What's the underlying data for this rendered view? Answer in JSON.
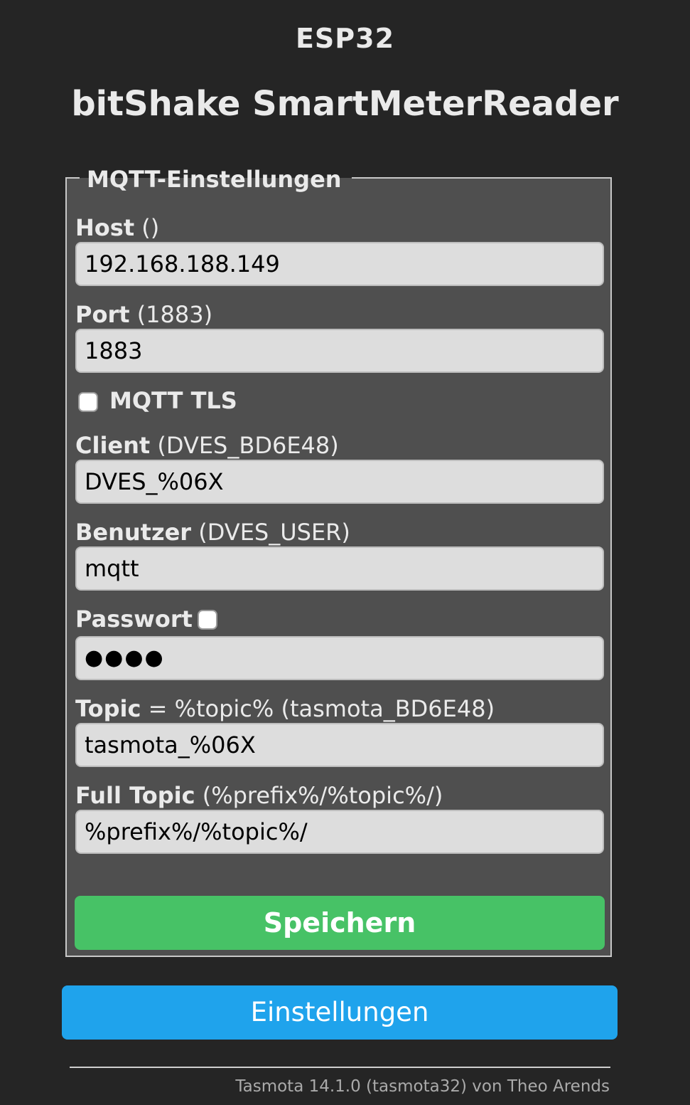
{
  "header": {
    "device_name": "ESP32",
    "app_title": "bitShake SmartMeterReader"
  },
  "mqtt_form": {
    "legend": "MQTT-Einstellungen",
    "host": {
      "label": "Host",
      "hint": "()",
      "value": "192.168.188.149"
    },
    "port": {
      "label": "Port",
      "hint": "(1883)",
      "value": "1883"
    },
    "tls": {
      "label": "MQTT TLS",
      "checked": false
    },
    "client": {
      "label": "Client",
      "hint": "(DVES_BD6E48)",
      "value": "DVES_%06X"
    },
    "user": {
      "label": "Benutzer",
      "hint": "(DVES_USER)",
      "value": "mqtt"
    },
    "password": {
      "label": "Passwort",
      "show_checked": false,
      "value": "●●●●"
    },
    "topic": {
      "label": "Topic",
      "hint": "= %topic% (tasmota_BD6E48)",
      "value": "tasmota_%06X"
    },
    "full_topic": {
      "label": "Full Topic",
      "hint": "(%prefix%/%topic%/)",
      "value": "%prefix%/%topic%/"
    },
    "save_label": "Speichern"
  },
  "nav": {
    "settings_label": "Einstellungen"
  },
  "footer": {
    "text": "Tasmota 14.1.0 (tasmota32) von Theo Arends"
  },
  "colors": {
    "background": "#252525",
    "panel": "#4f4f4f",
    "input_bg": "#dddddd",
    "save_button": "#47c266",
    "settings_button": "#1fa3ec"
  }
}
